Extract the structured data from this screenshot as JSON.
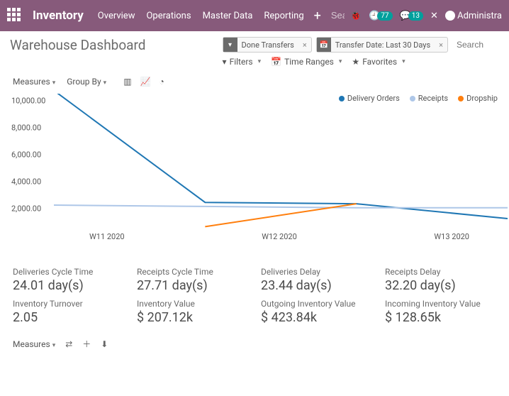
{
  "header": {
    "brand": "Inventory",
    "menu": [
      "Overview",
      "Operations",
      "Master Data",
      "Reporting"
    ],
    "search_placeholder": "Search",
    "activities_badge": "77",
    "messages_badge": "13",
    "user": "Administra"
  },
  "page": {
    "title": "Warehouse Dashboard",
    "filter_pills": [
      {
        "icon": "funnel",
        "label": "Done Transfers"
      },
      {
        "icon": "calendar",
        "label": "Transfer Date: Last 30 Days"
      }
    ],
    "search_placeholder": "Search",
    "filterbar": {
      "filters": "Filters",
      "time_ranges": "Time Ranges",
      "favorites": "Favorites"
    }
  },
  "toolbar": {
    "measures": "Measures",
    "groupby": "Group By"
  },
  "legend": [
    {
      "label": "Delivery Orders",
      "color": "#1f77b4"
    },
    {
      "label": "Receipts",
      "color": "#aec7e8"
    },
    {
      "label": "Dropship",
      "color": "#ff7f0e"
    }
  ],
  "chart_data": {
    "type": "line",
    "categories": [
      "W11 2020",
      "W12 2020",
      "W13 2020"
    ],
    "ylim": [
      0,
      10000
    ],
    "ylabel": "",
    "yticks": [
      "10,000.00",
      "8,000.00",
      "6,000.00",
      "4,000.00",
      "2,000.00"
    ],
    "series": [
      {
        "name": "Delivery Orders",
        "color": "#1f77b4",
        "values": [
          10500,
          2200,
          2100,
          1000
        ]
      },
      {
        "name": "Receipts",
        "color": "#aec7e8",
        "values": [
          2000,
          1900,
          1800,
          1800
        ]
      },
      {
        "name": "Dropship",
        "color": "#ff7f0e",
        "values": [
          null,
          400,
          2100,
          null
        ]
      }
    ]
  },
  "kpis": [
    {
      "label": "Deliveries Cycle Time",
      "value": "24.01 day(s)"
    },
    {
      "label": "Receipts Cycle Time",
      "value": "27.71 day(s)"
    },
    {
      "label": "Deliveries Delay",
      "value": "23.44 day(s)"
    },
    {
      "label": "Receipts Delay",
      "value": "32.20 day(s)"
    },
    {
      "label": "Inventory Turnover",
      "value": "2.05"
    },
    {
      "label": "Inventory Value",
      "value": "$ 207.12k"
    },
    {
      "label": "Outgoing Inventory Value",
      "value": "$ 423.84k"
    },
    {
      "label": "Incoming Inventory Value",
      "value": "$ 128.65k"
    }
  ],
  "bottombar": {
    "measures": "Measures"
  }
}
